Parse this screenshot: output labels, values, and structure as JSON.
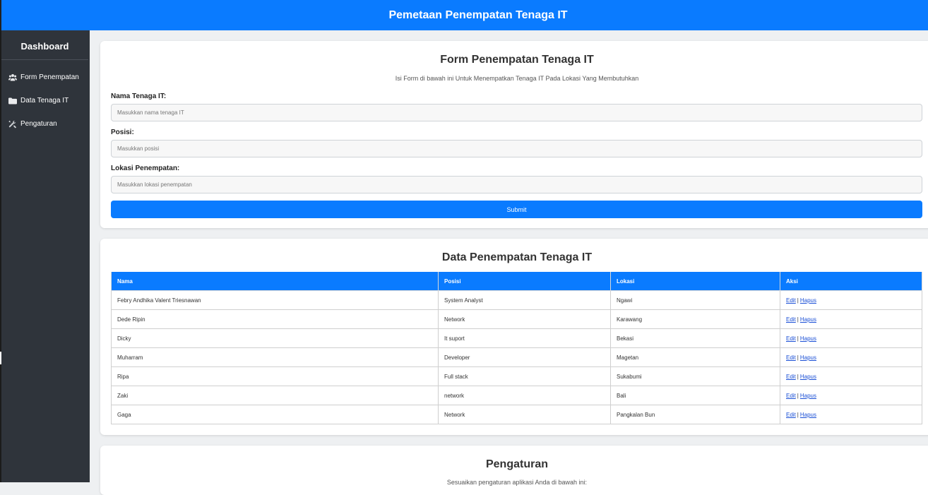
{
  "header": {
    "title": "Pemetaan Penempatan Tenaga IT"
  },
  "sidebar": {
    "brand": "Dashboard",
    "items": [
      {
        "label": "Form Penempatan",
        "icon": "users-icon"
      },
      {
        "label": "Data Tenaga IT",
        "icon": "folder-icon"
      },
      {
        "label": "Pengaturan",
        "icon": "tools-icon"
      }
    ]
  },
  "form": {
    "title": "Form Penempatan Tenaga IT",
    "subtitle": "Isi Form di bawah ini Untuk Menempatkan Tenaga IT Pada Lokasi Yang Membutuhkan",
    "fields": [
      {
        "label": "Nama Tenaga IT:",
        "placeholder": "Masukkan nama tenaga IT",
        "value": ""
      },
      {
        "label": "Posisi:",
        "placeholder": "Masukkan posisi",
        "value": ""
      },
      {
        "label": "Lokasi Penempatan:",
        "placeholder": "Masukkan lokasi penempatan",
        "value": ""
      }
    ],
    "submit_label": "Submit"
  },
  "data_section": {
    "title": "Data Penempatan Tenaga IT",
    "columns": [
      "Nama",
      "Posisi",
      "Lokasi",
      "Aksi"
    ],
    "edit_label": "Edit",
    "separator": "|",
    "delete_label": "Hapus",
    "rows": [
      {
        "nama": "Febry Andhika Valent Triesnawan",
        "posisi": "System Analyst",
        "lokasi": "Ngawi"
      },
      {
        "nama": "Dede Ripin",
        "posisi": "Network",
        "lokasi": "Karawang"
      },
      {
        "nama": "Dicky",
        "posisi": "It suport",
        "lokasi": "Bekasi"
      },
      {
        "nama": "Muharram",
        "posisi": "Developer",
        "lokasi": "Magetan"
      },
      {
        "nama": "Ripa",
        "posisi": "Full stack",
        "lokasi": "Sukabumi"
      },
      {
        "nama": "Zaki",
        "posisi": "network",
        "lokasi": "Bali"
      },
      {
        "nama": "Gaga",
        "posisi": "Network",
        "lokasi": "Pangkalan Bun"
      }
    ]
  },
  "settings": {
    "title": "Pengaturan",
    "subtitle": "Sesuaikan pengaturan aplikasi Anda di bawah ini:"
  },
  "colors": {
    "primary": "#0a7bff",
    "sidebar": "#2f343b",
    "background": "#eef0f2"
  }
}
